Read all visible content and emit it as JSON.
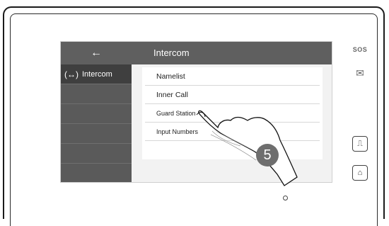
{
  "topbar": {
    "back_symbol": "←",
    "title": "Intercom"
  },
  "sidebar": {
    "items": [
      {
        "icon": "(↔)",
        "label": "Intercom"
      }
    ]
  },
  "list": {
    "items": [
      "Namelist",
      "Inner Call",
      "Guard Station",
      "Input Numbers"
    ]
  },
  "side_buttons": {
    "sos": "SOS",
    "mail": "✉",
    "door": "⎍",
    "chat": "⌂"
  },
  "annotation": {
    "step": "5"
  },
  "icons": [
    "back-arrow-icon",
    "intercom-icon",
    "mail-icon",
    "door-icon",
    "chat-icon",
    "pointing-hand-icon"
  ]
}
